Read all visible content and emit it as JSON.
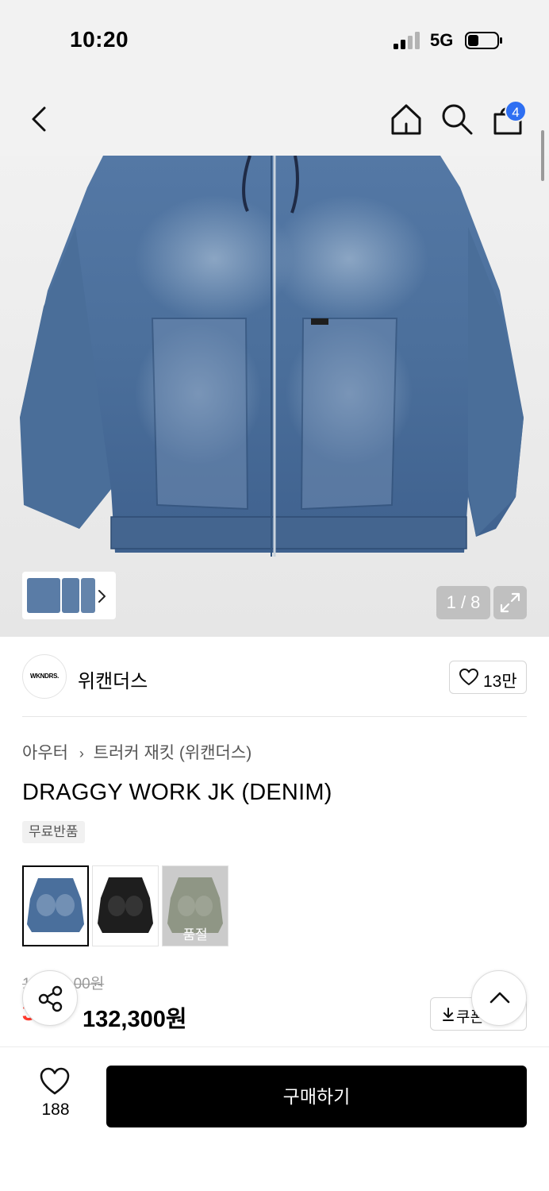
{
  "status_bar": {
    "time": "10:20",
    "network": "5G"
  },
  "header": {
    "cart_count": "4"
  },
  "gallery": {
    "counter": "1 / 8"
  },
  "brand": {
    "logo_text": "WKNDRS.",
    "name": "위캔더스",
    "likes": "13만"
  },
  "product": {
    "breadcrumb": [
      "아우터",
      "트러커 재킷 (위캔더스)"
    ],
    "title": "DRAGGY WORK JK (DENIM)",
    "tag": "무료반품",
    "swatches": [
      {
        "color_name": "denim",
        "color": "#4a6f9c",
        "selected": true
      },
      {
        "color_name": "black",
        "color": "#1e1e1e",
        "selected": false
      },
      {
        "color_name": "olive",
        "color": "#7a8a64",
        "selected": false,
        "sold_out_label": "품절"
      }
    ]
  },
  "price": {
    "original": "1",
    "original_tail": "00원",
    "discount": "3",
    "sale": "132,300원"
  },
  "coupon": {
    "label": "쿠폰"
  },
  "bottom_bar": {
    "wish_count": "188",
    "buy_label": "구매하기"
  },
  "colors": {
    "accent_blue": "#2e6ff2",
    "discount_red": "#ff3a2e",
    "buy_button": "#000000"
  }
}
